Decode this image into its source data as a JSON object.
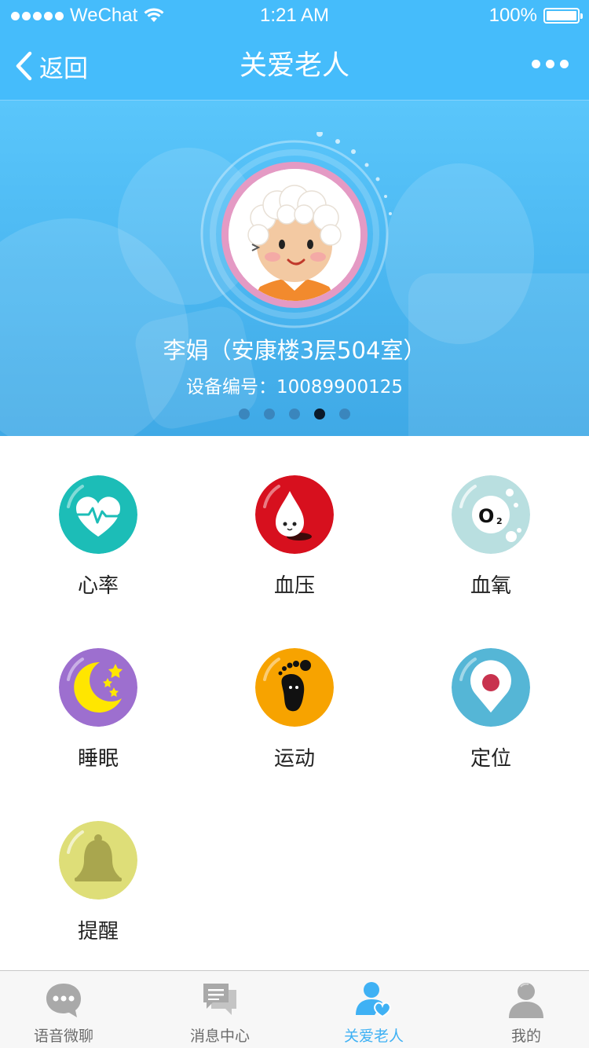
{
  "status_bar": {
    "carrier": "WeChat",
    "time": "1:21 AM",
    "battery": "100%"
  },
  "nav": {
    "back_label": "返回",
    "title": "关爱老人"
  },
  "profile": {
    "name": "李娟（安康楼3层504室）",
    "device_id": "设备编号：10089900125",
    "pager_total": 5,
    "pager_active_index": 3
  },
  "features": [
    {
      "label": "心率",
      "icon": "heart-rate-icon",
      "color": "#1cbdb7"
    },
    {
      "label": "血压",
      "icon": "blood-drop-icon",
      "color": "#d7101e"
    },
    {
      "label": "血氧",
      "icon": "oxygen-icon",
      "color": "#b9dfe0"
    },
    {
      "label": "睡眠",
      "icon": "moon-stars-icon",
      "color": "#9d6fcf"
    },
    {
      "label": "运动",
      "icon": "footprint-icon",
      "color": "#f7a300"
    },
    {
      "label": "定位",
      "icon": "location-pin-icon",
      "color": "#55b6d6"
    },
    {
      "label": "提醒",
      "icon": "bell-icon",
      "color": "#dede78"
    }
  ],
  "tabs": [
    {
      "label": "语音微聊",
      "icon": "chat-bubble-icon",
      "active": false
    },
    {
      "label": "消息中心",
      "icon": "messages-icon",
      "active": false
    },
    {
      "label": "关爱老人",
      "icon": "care-elderly-icon",
      "active": true
    },
    {
      "label": "我的",
      "icon": "profile-icon",
      "active": false
    }
  ],
  "colors": {
    "primary": "#45bcfb",
    "tab_active": "#3fb1f4",
    "tab_inactive": "#a9a9a9"
  }
}
